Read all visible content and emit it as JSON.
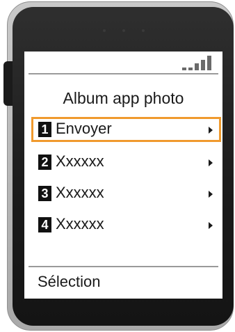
{
  "status": {
    "signal_bars": 4
  },
  "screen": {
    "title": "Album app photo",
    "menu": [
      {
        "number": "1",
        "label": "Envoyer",
        "selected": true
      },
      {
        "number": "2",
        "label": "Xxxxxx",
        "selected": false
      },
      {
        "number": "3",
        "label": "Xxxxxx",
        "selected": false
      },
      {
        "number": "4",
        "label": "Xxxxxx",
        "selected": false
      }
    ],
    "softkey": "Sélection"
  },
  "colors": {
    "highlight": "#f09a2e",
    "bezel": "#1c1c1c",
    "frame": "#b5b5b5"
  }
}
